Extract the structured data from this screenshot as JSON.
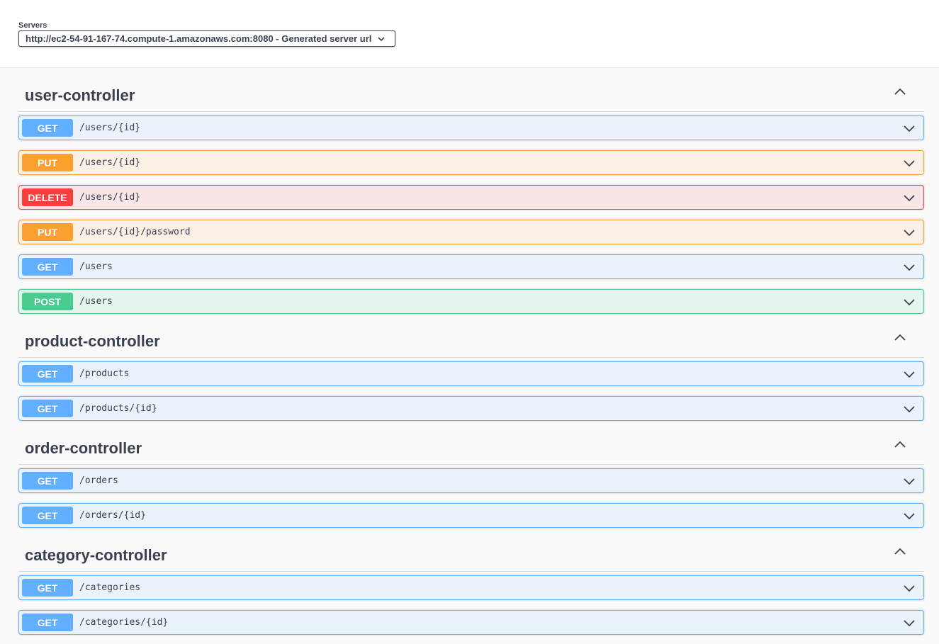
{
  "servers": {
    "label": "Servers",
    "selected": "http://ec2-54-91-167-74.compute-1.amazonaws.com:8080 - Generated server url"
  },
  "colors": {
    "get": "#61affe",
    "put": "#fca130",
    "delete": "#f93e3e",
    "post": "#49cc90"
  },
  "tags": [
    {
      "name": "user-controller",
      "ops": [
        {
          "method": "GET",
          "path": "/users/{id}"
        },
        {
          "method": "PUT",
          "path": "/users/{id}"
        },
        {
          "method": "DELETE",
          "path": "/users/{id}"
        },
        {
          "method": "PUT",
          "path": "/users/{id}/password"
        },
        {
          "method": "GET",
          "path": "/users"
        },
        {
          "method": "POST",
          "path": "/users"
        }
      ]
    },
    {
      "name": "product-controller",
      "ops": [
        {
          "method": "GET",
          "path": "/products"
        },
        {
          "method": "GET",
          "path": "/products/{id}"
        }
      ]
    },
    {
      "name": "order-controller",
      "ops": [
        {
          "method": "GET",
          "path": "/orders"
        },
        {
          "method": "GET",
          "path": "/orders/{id}"
        }
      ]
    },
    {
      "name": "category-controller",
      "ops": [
        {
          "method": "GET",
          "path": "/categories"
        },
        {
          "method": "GET",
          "path": "/categories/{id}"
        }
      ]
    }
  ],
  "icons": {
    "server_dropdown": "chevron-down-icon",
    "tag_toggle": "chevron-up-icon",
    "op_toggle": "chevron-down-icon"
  }
}
